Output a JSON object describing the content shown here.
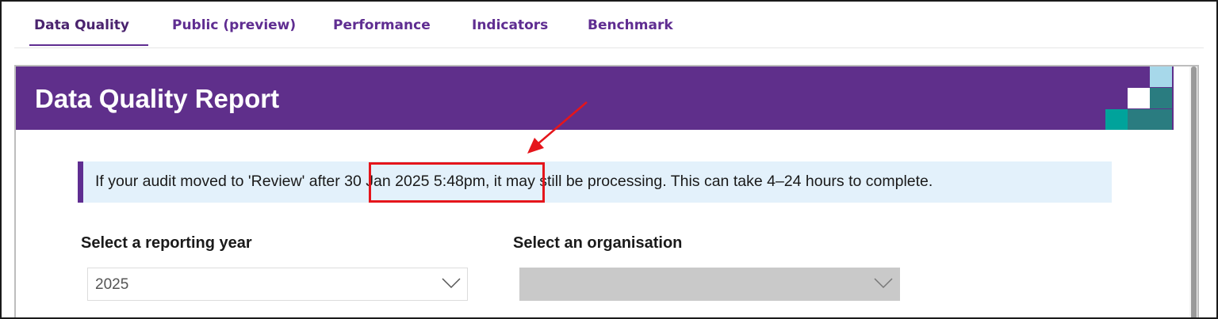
{
  "tabs": [
    {
      "label": "Data Quality",
      "active": true
    },
    {
      "label": "Public (preview)",
      "active": false
    },
    {
      "label": "Performance",
      "active": false
    },
    {
      "label": "Indicators",
      "active": false
    },
    {
      "label": "Benchmark",
      "active": false
    }
  ],
  "report": {
    "title": "Data Quality Report"
  },
  "notice": {
    "text": "If your audit moved to 'Review' after 30 Jan 2025 5:48pm, it may still be processing. This can take 4–24 hours to complete.",
    "highlighted_timestamp": "30 Jan 2025 5:48pm,"
  },
  "filters": {
    "year": {
      "label": "Select a reporting year",
      "value": "2025"
    },
    "organisation": {
      "label": "Select an organisation",
      "value": "",
      "disabled": true
    }
  },
  "colors": {
    "brand_purple": "#5f2f8b",
    "tab_purple": "#5f2d91",
    "notice_background": "#e3f1fb",
    "annotation_red": "#e5151b",
    "logo_light_blue": "#a7d8ea",
    "logo_teal": "#2a7c80",
    "logo_green": "#00a39b"
  },
  "icons": {
    "dropdown": "chevron-down-icon",
    "annotation": "arrow-annotation",
    "logo": "pixel-squares-logo"
  }
}
